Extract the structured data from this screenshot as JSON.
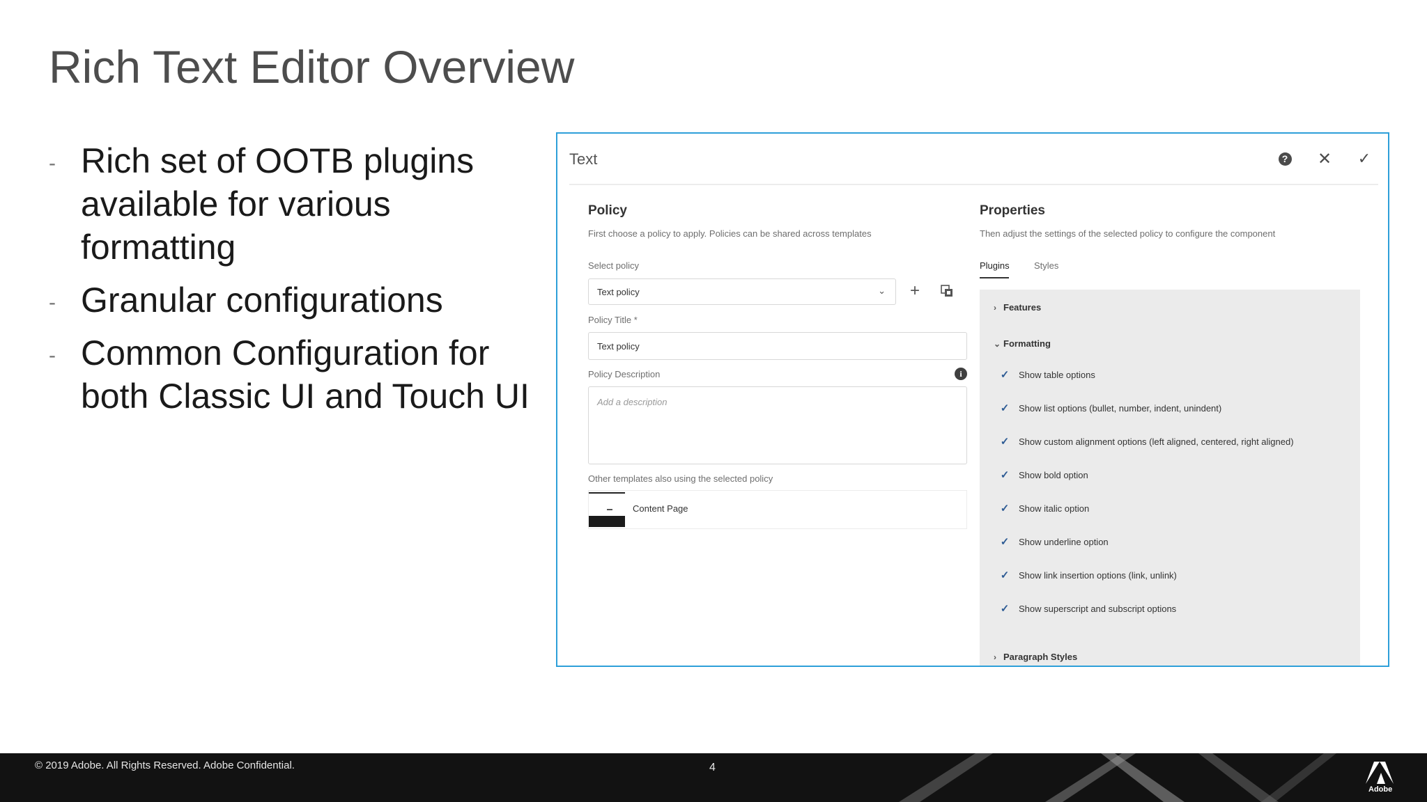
{
  "slide": {
    "title": "Rich Text Editor Overview",
    "bullets": [
      "Rich set of OOTB plugins available for various formatting",
      "Granular configurations",
      "Common Configuration for both Classic UI and Touch UI"
    ],
    "bullet_marker": "-"
  },
  "dialog": {
    "title": "Text",
    "header_icons": [
      "help-icon",
      "close-icon",
      "checkmark-icon"
    ],
    "policy": {
      "heading": "Policy",
      "description": "First choose a policy to apply. Policies can be shared across templates",
      "select_label": "Select policy",
      "select_value": "Text policy",
      "title_label": "Policy Title *",
      "title_value": "Text policy",
      "description_label": "Policy Description",
      "description_placeholder": "Add a description",
      "other_templates_label": "Other templates also using the selected policy",
      "template_name": "Content Page"
    },
    "properties": {
      "heading": "Properties",
      "description": "Then adjust the settings of the selected policy to configure the component",
      "tabs": [
        "Plugins",
        "Styles"
      ],
      "active_tab": "Plugins",
      "sections": {
        "features": "Features",
        "formatting": "Formatting",
        "paragraph_styles": "Paragraph Styles"
      },
      "formatting_options": [
        "Show table options",
        "Show list options (bullet, number, indent, unindent)",
        "Show custom alignment options (left aligned, centered, right aligned)",
        "Show bold option",
        "Show italic option",
        "Show underline option",
        "Show link insertion options (link, unlink)",
        "Show superscript and subscript options"
      ]
    }
  },
  "footer": {
    "copyright": "© 2019 Adobe.  All Rights Reserved.  Adobe Confidential.",
    "page_number": "4",
    "logo_text": "Adobe"
  },
  "colors": {
    "dialog_border": "#2d9fd9",
    "footer_bg": "#121212",
    "checkmark": "#2d5b94"
  }
}
